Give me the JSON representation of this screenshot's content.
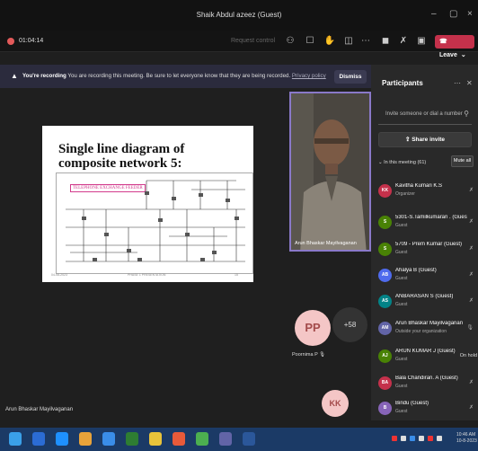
{
  "window": {
    "title": "Shaik Abdul azeez (Guest)",
    "min": "–",
    "max": "▢",
    "close": "×"
  },
  "toolbar": {
    "timer": "01:04:14",
    "request_control": "Request control",
    "leave": "Leave"
  },
  "banner": {
    "title": "You're recording",
    "text": "You are recording this meeting. Be sure to let everyone know that they are being recorded.",
    "link": "Privacy policy",
    "dismiss": "Dismiss"
  },
  "slide": {
    "title_line1": "Single line diagram of",
    "title_line2": "composite network 5:",
    "box_label": "TELEPHONE EXCHANGE FEEDER",
    "footer_left": "04-08-2023",
    "footer_center": "PHASE 1 PRESENTATION",
    "footer_right": "15"
  },
  "presenter_name": "Arun Bhaskar Mayilvaganan",
  "video_name": "Arun Bhaskar Mayilvaganan",
  "tiles": {
    "pp": "PP",
    "plus": "+58",
    "pp_name": "Poornima P",
    "kk": "KK"
  },
  "panel": {
    "title": "Participants",
    "invite_placeholder": "Invite someone or dial a number",
    "share": "Share invite",
    "in_meeting": "In this meeting (61)",
    "mute_all": "Mute all",
    "participants": [
      {
        "initials": "KK",
        "name": "Kavitha Kumari K.S",
        "role": "Organizer",
        "color": "#c4314b"
      },
      {
        "initials": "S",
        "name": "5301-S.Tamilkumaran . (Guest)",
        "role": "Guest",
        "color": "#498205"
      },
      {
        "initials": "S",
        "name": "5709 - Prem Kumar (Guest)",
        "role": "Guest",
        "color": "#498205"
      },
      {
        "initials": "AB",
        "name": "Ahalya B (Guest)",
        "role": "Guest",
        "color": "#4f6bed"
      },
      {
        "initials": "AS",
        "name": "ANBARASAN S (Guest)",
        "role": "Guest",
        "color": "#038387"
      },
      {
        "initials": "AM",
        "name": "Arun Bhaskar Mayilvaganan",
        "role": "Outside your organization",
        "color": "#6264a7"
      },
      {
        "initials": "AJ",
        "name": "ARUN KUMAR J (Guest)",
        "role": "Guest",
        "color": "#498205"
      },
      {
        "initials": "BA",
        "name": "Bala Chandiran. A (Guest)",
        "role": "Guest",
        "color": "#c4314b"
      },
      {
        "initials": "B",
        "name": "Bindu (Guest)",
        "role": "Guest",
        "color": "#8764b8"
      }
    ],
    "on_hold": "On hold"
  },
  "clock": {
    "time": "10:46 AM",
    "date": "10-8-2023"
  }
}
